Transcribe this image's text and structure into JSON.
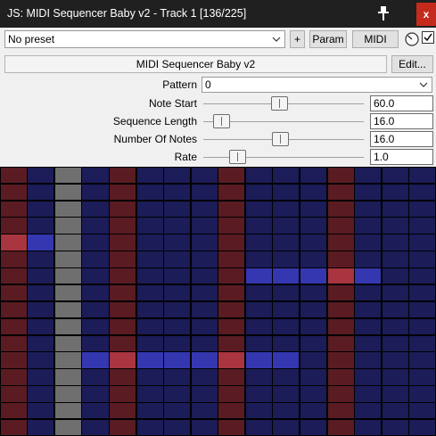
{
  "window": {
    "title": "JS: MIDI Sequencer Baby v2 - Track 1 [136/225]",
    "close_label": "x"
  },
  "toolbar": {
    "preset": "No preset",
    "plus_label": "+",
    "param_label": "Param",
    "midi_label": "MIDI",
    "bypass_checked": true
  },
  "plugin": {
    "name": "MIDI Sequencer Baby v2",
    "edit_label": "Edit..."
  },
  "params": {
    "pattern": {
      "label": "Pattern",
      "value": "0"
    },
    "sliders": [
      {
        "label": "Note Start",
        "value": "60.0",
        "fraction": 0.47
      },
      {
        "label": "Sequence Length",
        "value": "16.0",
        "fraction": 0.07
      },
      {
        "label": "Number Of Notes",
        "value": "16.0",
        "fraction": 0.48
      },
      {
        "label": "Rate",
        "value": "1.0",
        "fraction": 0.18
      }
    ]
  },
  "sequencer": {
    "columns": 16,
    "rows": 16,
    "playhead_column": 2,
    "bar_columns": [
      0,
      4,
      8,
      12
    ],
    "active_cells": [
      {
        "row": 4,
        "col": 0
      },
      {
        "row": 4,
        "col": 1
      },
      {
        "row": 6,
        "col": 9
      },
      {
        "row": 6,
        "col": 10
      },
      {
        "row": 6,
        "col": 11
      },
      {
        "row": 6,
        "col": 12
      },
      {
        "row": 6,
        "col": 13
      },
      {
        "row": 11,
        "col": 3
      },
      {
        "row": 11,
        "col": 4
      },
      {
        "row": 11,
        "col": 5
      },
      {
        "row": 11,
        "col": 6
      },
      {
        "row": 11,
        "col": 7
      },
      {
        "row": 11,
        "col": 8
      },
      {
        "row": 11,
        "col": 9
      },
      {
        "row": 11,
        "col": 10
      }
    ],
    "colors": {
      "normal": "#1b1c58",
      "bar": "#5a1c22",
      "playhead": "#6f6f6f",
      "active_normal": "#3437b0",
      "active_bar": "#a8353f"
    }
  }
}
